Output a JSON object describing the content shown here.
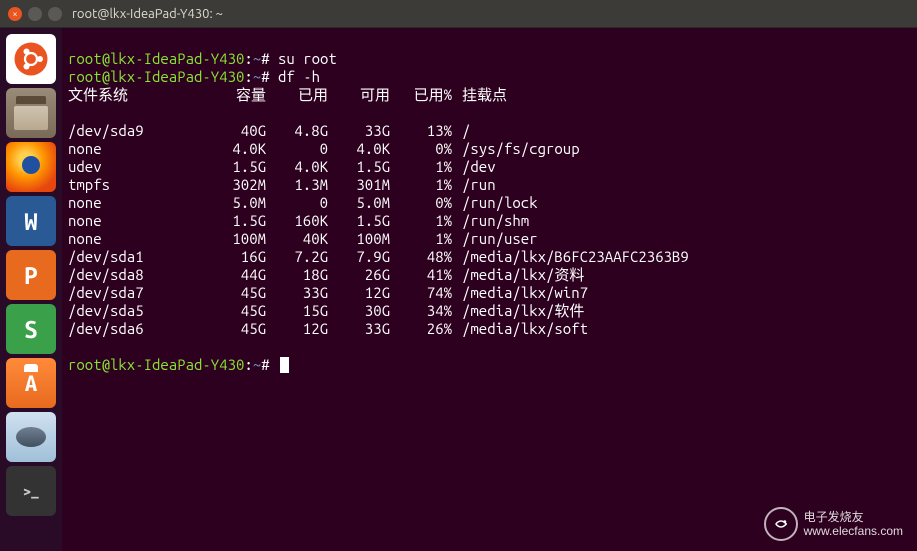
{
  "window": {
    "title": "root@lkx-IdeaPad-Y430: ~"
  },
  "prompt": {
    "user_host": "root@lkx-IdeaPad-Y430",
    "path": "~",
    "sep": ":",
    "symbol": "#"
  },
  "commands": {
    "cmd1": "su root",
    "cmd2": "df -h"
  },
  "df": {
    "headers": {
      "fs": "文件系统",
      "size": "容量",
      "used": "已用",
      "avail": "可用",
      "pct": "已用%",
      "mount": "挂载点"
    },
    "rows": [
      {
        "fs": "/dev/sda9",
        "size": "40G",
        "used": "4.8G",
        "avail": "33G",
        "pct": "13%",
        "mount": "/"
      },
      {
        "fs": "none",
        "size": "4.0K",
        "used": "0",
        "avail": "4.0K",
        "pct": "0%",
        "mount": "/sys/fs/cgroup"
      },
      {
        "fs": "udev",
        "size": "1.5G",
        "used": "4.0K",
        "avail": "1.5G",
        "pct": "1%",
        "mount": "/dev"
      },
      {
        "fs": "tmpfs",
        "size": "302M",
        "used": "1.3M",
        "avail": "301M",
        "pct": "1%",
        "mount": "/run"
      },
      {
        "fs": "none",
        "size": "5.0M",
        "used": "0",
        "avail": "5.0M",
        "pct": "0%",
        "mount": "/run/lock"
      },
      {
        "fs": "none",
        "size": "1.5G",
        "used": "160K",
        "avail": "1.5G",
        "pct": "1%",
        "mount": "/run/shm"
      },
      {
        "fs": "none",
        "size": "100M",
        "used": "40K",
        "avail": "100M",
        "pct": "1%",
        "mount": "/run/user"
      },
      {
        "fs": "/dev/sda1",
        "size": "16G",
        "used": "7.2G",
        "avail": "7.9G",
        "pct": "48%",
        "mount": "/media/lkx/B6FC23AAFC2363B9"
      },
      {
        "fs": "/dev/sda8",
        "size": "44G",
        "used": "18G",
        "avail": "26G",
        "pct": "41%",
        "mount": "/media/lkx/资料"
      },
      {
        "fs": "/dev/sda7",
        "size": "45G",
        "used": "33G",
        "avail": "12G",
        "pct": "74%",
        "mount": "/media/lkx/win7"
      },
      {
        "fs": "/dev/sda5",
        "size": "45G",
        "used": "15G",
        "avail": "30G",
        "pct": "34%",
        "mount": "/media/lkx/软件"
      },
      {
        "fs": "/dev/sda6",
        "size": "45G",
        "used": "12G",
        "avail": "33G",
        "pct": "26%",
        "mount": "/media/lkx/soft"
      }
    ]
  },
  "launcher": {
    "items": [
      {
        "name": "ubuntu-dash",
        "label": ""
      },
      {
        "name": "files",
        "label": ""
      },
      {
        "name": "firefox",
        "label": ""
      },
      {
        "name": "wps-writer",
        "label": "W"
      },
      {
        "name": "wps-presentation",
        "label": "P"
      },
      {
        "name": "wps-spreadsheet",
        "label": "S"
      },
      {
        "name": "software-center",
        "label": ""
      },
      {
        "name": "disk-utility",
        "label": ""
      },
      {
        "name": "terminal",
        "label": ">_"
      }
    ]
  },
  "watermark": {
    "brand": "电子发烧友",
    "url": "www.elecfans.com"
  }
}
